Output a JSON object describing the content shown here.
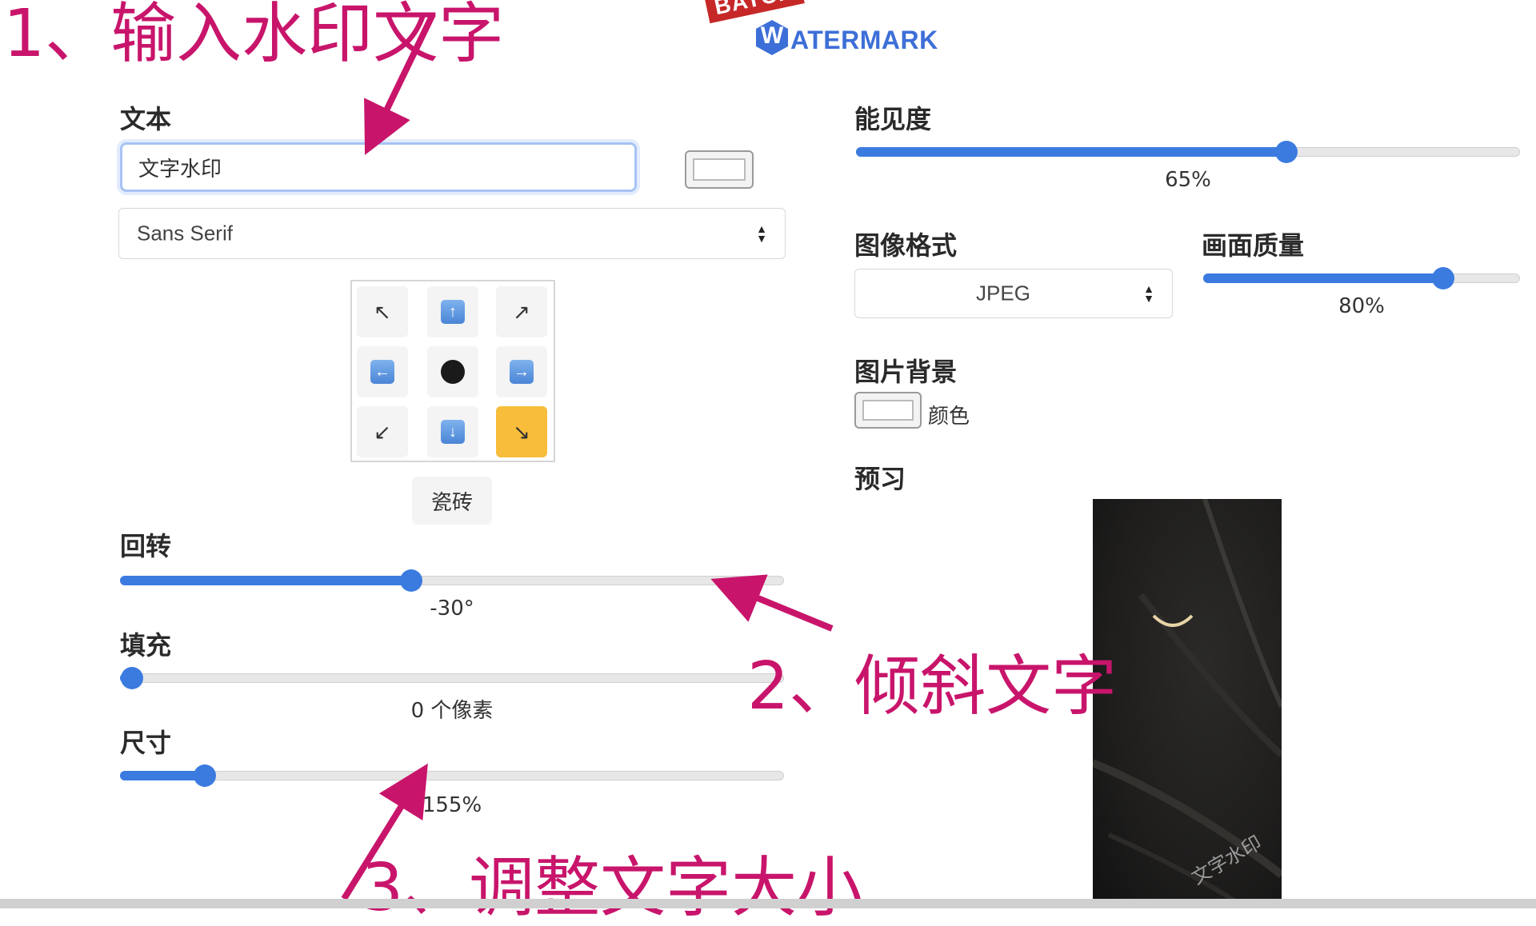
{
  "annotations": {
    "step1": "1、输入水印文字",
    "step2": "2、倾斜文字",
    "step3": "3、调整文字大小"
  },
  "logo": {
    "badge": "BATCH",
    "initial": "W",
    "word": "ATERMARK"
  },
  "text_section": {
    "label": "文本",
    "input_value": "文字水印",
    "font_select": "Sans Serif"
  },
  "position_grid": {
    "cells": [
      {
        "name": "top-left-arrow-icon",
        "glyph": "↖"
      },
      {
        "name": "top-arrow-icon",
        "glyph": "⬆"
      },
      {
        "name": "top-right-arrow-icon",
        "glyph": "↗"
      },
      {
        "name": "left-arrow-icon",
        "glyph": "⬅"
      },
      {
        "name": "center-dot-icon",
        "glyph": ""
      },
      {
        "name": "right-arrow-icon",
        "glyph": "➡"
      },
      {
        "name": "bottom-left-arrow-icon",
        "glyph": "↙"
      },
      {
        "name": "bottom-arrow-icon",
        "glyph": "⬇"
      },
      {
        "name": "bottom-right-arrow-icon",
        "glyph": "↘"
      }
    ],
    "selected": "bottom-right",
    "tile_button": "瓷砖"
  },
  "rotation": {
    "label": "回转",
    "value_text": "-30°",
    "fraction": 0.42
  },
  "padding": {
    "label": "填充",
    "value_text": "0 个像素",
    "fraction": 0.0
  },
  "size": {
    "label": "尺寸",
    "value_text": "155%",
    "fraction": 0.11
  },
  "visibility": {
    "label": "能见度",
    "value_text": "65%",
    "fraction": 0.63
  },
  "image_format": {
    "label": "图像格式",
    "selected": "JPEG"
  },
  "quality": {
    "label": "画面质量",
    "value_text": "80%",
    "fraction": 0.72
  },
  "background": {
    "label": "图片背景",
    "color_label": "颜色"
  },
  "preview": {
    "label": "预习",
    "watermark_text": "文字水印"
  },
  "colors": {
    "accent": "#3b7be0",
    "annotation": "#c8156b",
    "highlight": "#f7bd3b"
  }
}
